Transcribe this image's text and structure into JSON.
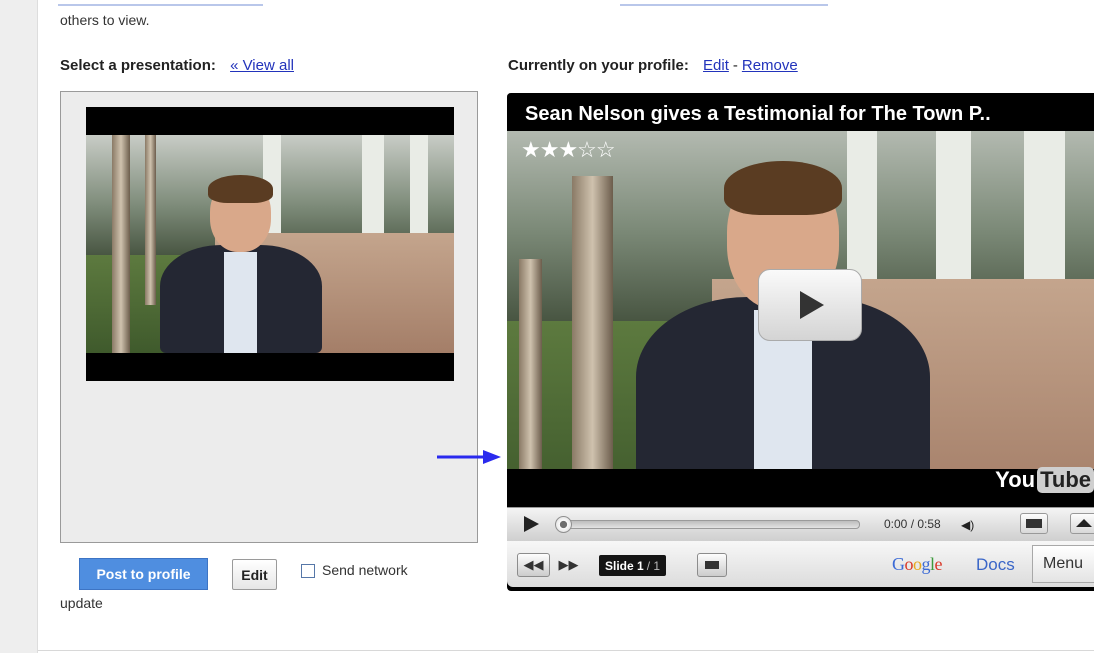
{
  "intro": {
    "text": "others to view."
  },
  "select_section": {
    "label": "Select a presentation:",
    "view_all_link": "« View all"
  },
  "profile_section": {
    "label": "Currently on your profile:",
    "edit_link": "Edit",
    "separator": "-",
    "remove_link": "Remove"
  },
  "actions": {
    "post_label": "Post to profile",
    "edit_label": "Edit",
    "send_network_label": "Send network",
    "send_network_label_cont": "update",
    "send_network_checked": false
  },
  "player": {
    "title": "Sean Nelson gives a Testimonial for The Town P..",
    "stars": "★★★☆☆",
    "rating": 3,
    "youtube_you": "You",
    "youtube_tube": "Tube",
    "time": "0:00 / 0:58",
    "progress": 0,
    "slide_label": "Slide 1",
    "slide_total": "/ 1",
    "google": [
      {
        "ch": "G",
        "color": "#3b6ad6"
      },
      {
        "ch": "o",
        "color": "#d93a2a"
      },
      {
        "ch": "o",
        "color": "#e8a81c"
      },
      {
        "ch": "g",
        "color": "#3b6ad6"
      },
      {
        "ch": "l",
        "color": "#3c9a3c"
      },
      {
        "ch": "e",
        "color": "#d93a2a"
      }
    ],
    "docs": "Docs",
    "menu": "Menu"
  },
  "colors": {
    "link": "#2233bb",
    "post_button": "#4f8ee0",
    "arrow": "#2a2aee"
  }
}
